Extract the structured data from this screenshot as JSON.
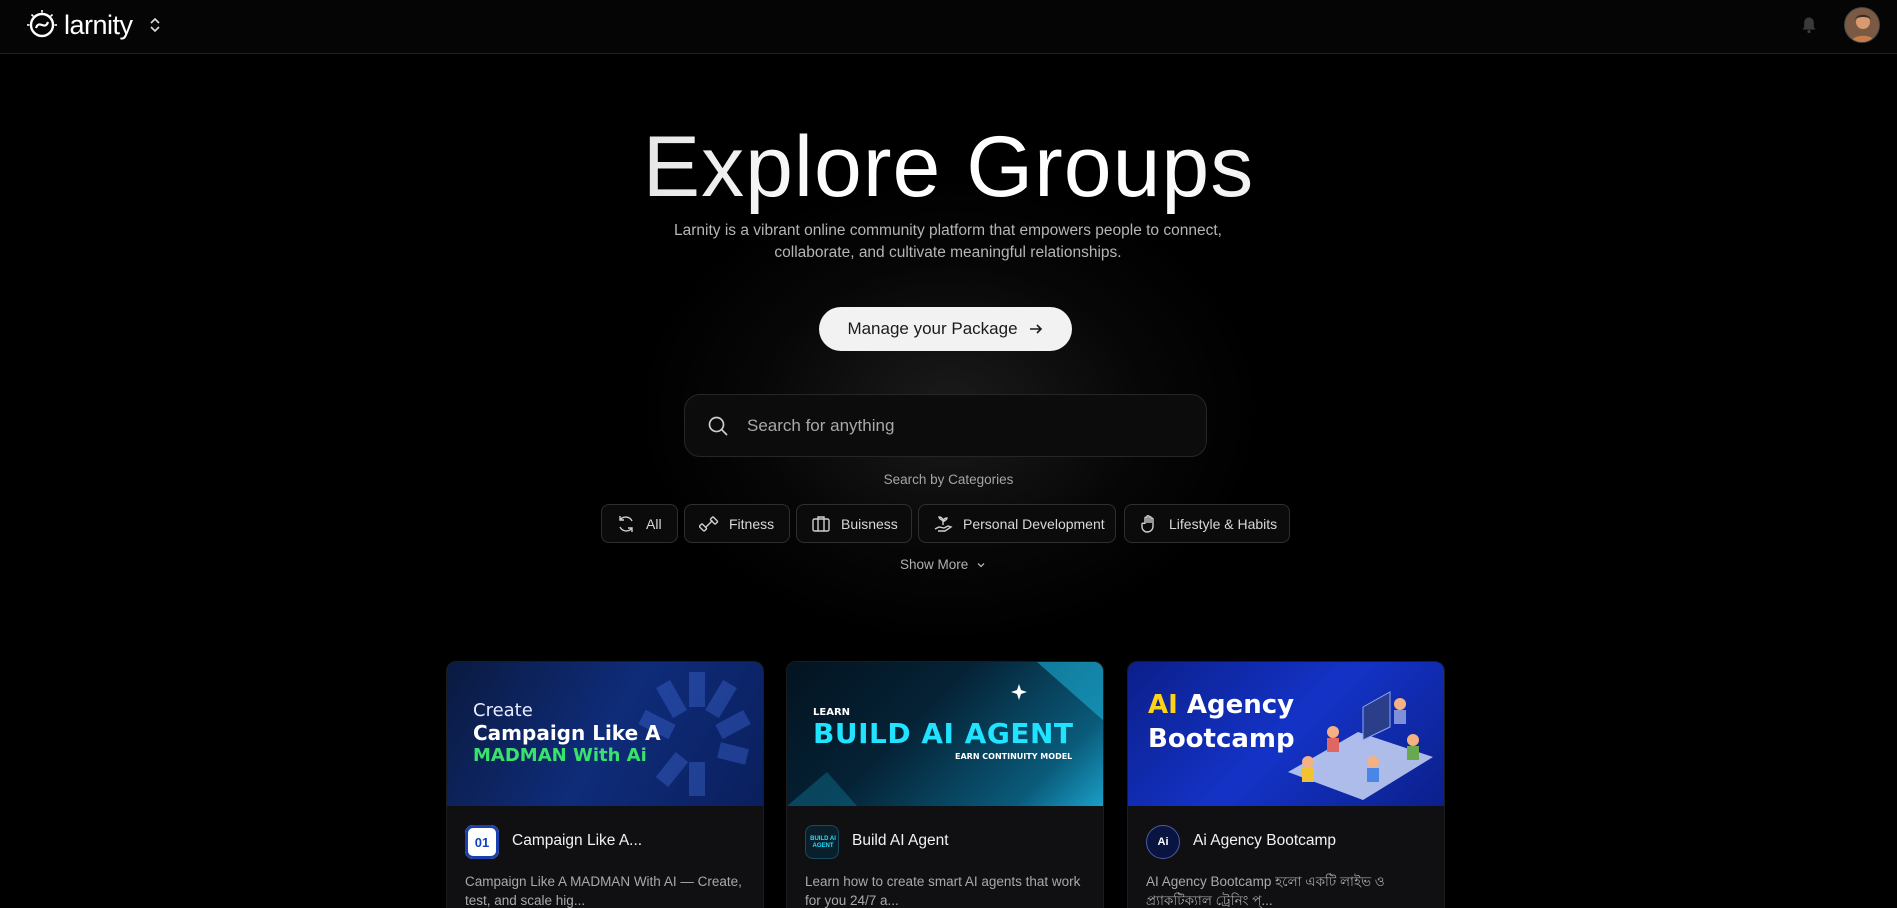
{
  "header": {
    "brand_name": "larnity",
    "logo_icon": "larnity-logo-icon",
    "switcher_icon": "chevron-up-down-icon",
    "notification_icon": "bell-icon",
    "avatar_icon": "user-avatar"
  },
  "hero": {
    "title": "Explore Groups",
    "subtitle": "Larnity is a vibrant online community platform that empowers people to connect, collaborate, and cultivate meaningful relationships.",
    "cta_label": "Manage your Package",
    "cta_icon": "arrow-right-icon"
  },
  "search": {
    "placeholder": "Search for anything",
    "value": "",
    "icon": "search-icon"
  },
  "categories": {
    "heading": "Search by Categories",
    "items": [
      {
        "label": "All",
        "icon": "refresh-icon"
      },
      {
        "label": "Fitness",
        "icon": "dumbbell-icon"
      },
      {
        "label": "Buisness",
        "icon": "briefcase-icon"
      },
      {
        "label": "Personal Development",
        "icon": "growth-hand-icon"
      },
      {
        "label": "Lifestyle & Habits",
        "icon": "hand-wave-icon"
      }
    ],
    "show_more": "Show More",
    "show_more_icon": "chevron-down-icon"
  },
  "groups": [
    {
      "title": "Campaign Like A...",
      "description": "Campaign Like A MADMAN With AI — Create, test, and scale hig...",
      "banner": {
        "line1": "Create",
        "line2": "Campaign Like A",
        "line3": "MADMAN With Ai"
      },
      "icon_text": "01"
    },
    {
      "title": "Build AI Agent",
      "description": "Learn how to create smart AI agents that work for you 24/7 a...",
      "banner": {
        "line1": "LEARN",
        "line2": "BUILD AI AGENT",
        "line3": "EARN CONTINUITY MODEL"
      },
      "icon_text": "BUILD AI AGENT"
    },
    {
      "title": "Ai Agency Bootcamp",
      "description": "AI Agency Bootcamp হলো একটি লাইভ ও প্র্যাকটিক্যাল ট্রেনিং প্...",
      "banner": {
        "line1a": "AI",
        "line1b": "Agency",
        "line2": "Bootcamp"
      },
      "icon_text": "Ai"
    }
  ],
  "colors": {
    "background": "#000000",
    "accent_green": "#39e36b",
    "accent_cyan": "#20e3ff",
    "accent_yellow": "#ffd21a"
  }
}
